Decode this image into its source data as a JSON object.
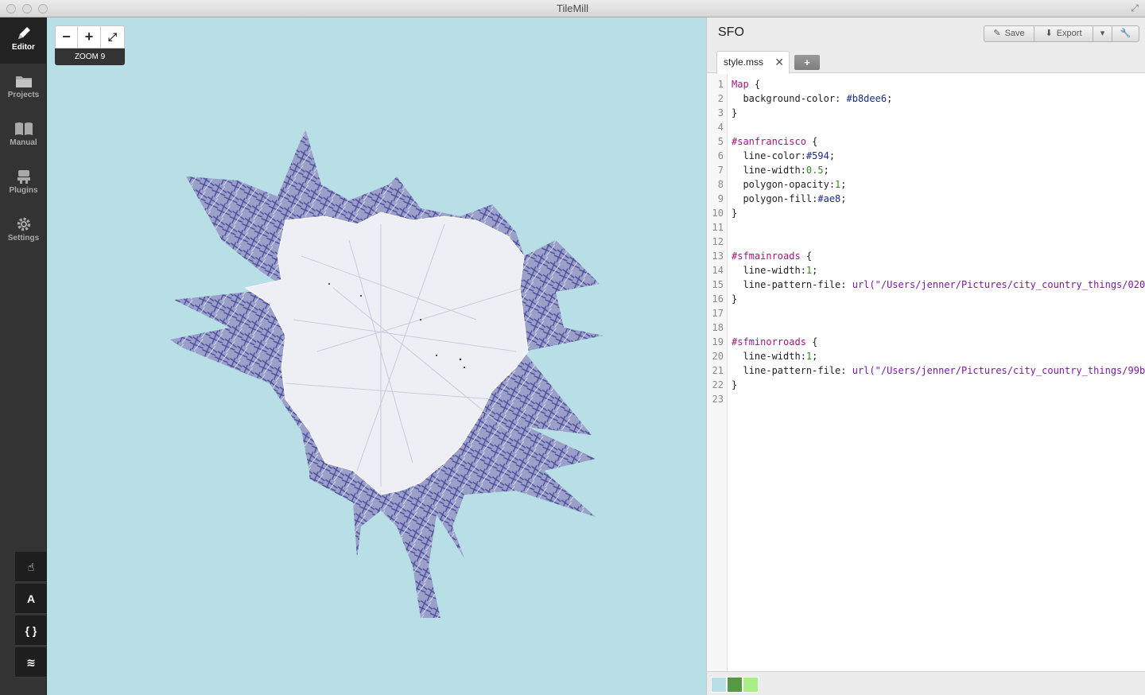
{
  "window": {
    "title": "TileMill"
  },
  "nav": {
    "items": [
      {
        "label": "Editor",
        "icon": "pencil-icon",
        "active": true
      },
      {
        "label": "Projects",
        "icon": "folder-icon",
        "active": false
      },
      {
        "label": "Manual",
        "icon": "book-icon",
        "active": false
      },
      {
        "label": "Plugins",
        "icon": "plugin-icon",
        "active": false
      },
      {
        "label": "Settings",
        "icon": "gear-icon",
        "active": false
      }
    ],
    "tools": [
      {
        "name": "pan-tool",
        "glyph": "☝"
      },
      {
        "name": "fonts-tool",
        "glyph": "A"
      },
      {
        "name": "carto-reference-tool",
        "glyph": "{ }"
      },
      {
        "name": "layers-tool",
        "glyph": "≋"
      }
    ]
  },
  "map": {
    "zoom_out": "−",
    "zoom_in": "+",
    "fullscreen": "⤢",
    "zoom_label": "ZOOM 9",
    "background": "#b8dee6"
  },
  "editor": {
    "project_title": "SFO",
    "save_label": "Save",
    "export_label": "Export",
    "active_tab": "style.mss",
    "tab_close": "✕",
    "add_tab": "+",
    "swatches": [
      "#b8dee6",
      "#559944",
      "#aaee88"
    ]
  },
  "code": [
    {
      "n": "1",
      "parts": [
        [
          "kw",
          "Map"
        ],
        [
          "",
          " {"
        ]
      ]
    },
    {
      "n": "2",
      "parts": [
        [
          "",
          "  background-color: "
        ],
        [
          "hex",
          "#b8dee6"
        ],
        [
          "",
          ";"
        ]
      ]
    },
    {
      "n": "3",
      "parts": [
        [
          "",
          "}"
        ]
      ]
    },
    {
      "n": "4",
      "parts": []
    },
    {
      "n": "5",
      "parts": [
        [
          "kw",
          "#sanfrancisco"
        ],
        [
          "",
          " {"
        ]
      ]
    },
    {
      "n": "6",
      "parts": [
        [
          "",
          "  line-color:"
        ],
        [
          "hex",
          "#594"
        ],
        [
          "",
          ";"
        ]
      ]
    },
    {
      "n": "7",
      "parts": [
        [
          "",
          "  line-width:"
        ],
        [
          "num",
          "0.5"
        ],
        [
          "",
          ";"
        ]
      ]
    },
    {
      "n": "8",
      "parts": [
        [
          "",
          "  polygon-opacity:"
        ],
        [
          "num",
          "1"
        ],
        [
          "",
          ";"
        ]
      ]
    },
    {
      "n": "9",
      "parts": [
        [
          "",
          "  polygon-fill:"
        ],
        [
          "hex",
          "#ae8"
        ],
        [
          "",
          ";"
        ]
      ]
    },
    {
      "n": "10",
      "parts": [
        [
          "",
          "}"
        ]
      ]
    },
    {
      "n": "11",
      "parts": []
    },
    {
      "n": "12",
      "parts": []
    },
    {
      "n": "13",
      "parts": [
        [
          "kw",
          "#sfmainroads"
        ],
        [
          "",
          " {"
        ]
      ]
    },
    {
      "n": "14",
      "parts": [
        [
          "",
          "  line-width:"
        ],
        [
          "num",
          "1"
        ],
        [
          "",
          ";"
        ]
      ]
    },
    {
      "n": "15",
      "parts": [
        [
          "",
          "  line-pattern-file: "
        ],
        [
          "str",
          "url(\"/Users/jenner/Pictures/city_country_things/020_"
        ]
      ]
    },
    {
      "n": "16",
      "parts": [
        [
          "",
          "}"
        ]
      ]
    },
    {
      "n": "17",
      "parts": []
    },
    {
      "n": "18",
      "parts": []
    },
    {
      "n": "19",
      "parts": [
        [
          "kw",
          "#sfminorroads"
        ],
        [
          "",
          " {"
        ]
      ]
    },
    {
      "n": "20",
      "parts": [
        [
          "",
          "  line-width:"
        ],
        [
          "num",
          "1"
        ],
        [
          "",
          ";"
        ]
      ]
    },
    {
      "n": "21",
      "parts": [
        [
          "",
          "  line-pattern-file: "
        ],
        [
          "str",
          "url(\"/Users/jenner/Pictures/city_country_things/99b"
        ]
      ]
    },
    {
      "n": "22",
      "parts": [
        [
          "",
          "}"
        ]
      ]
    },
    {
      "n": "23",
      "parts": []
    }
  ]
}
